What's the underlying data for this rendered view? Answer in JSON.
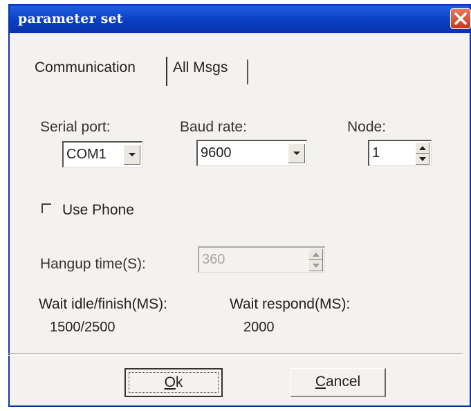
{
  "window": {
    "title": "parameter set"
  },
  "tabs": [
    {
      "label": "Communication",
      "active": true
    },
    {
      "label": "All Msgs",
      "active": false
    }
  ],
  "serial_port": {
    "label": "Serial port:",
    "value": "COM1"
  },
  "baud_rate": {
    "label": "Baud rate:",
    "value": "9600"
  },
  "node": {
    "label": "Node:",
    "value": "1"
  },
  "use_phone": {
    "label": "Use Phone",
    "checked": false
  },
  "hangup_time": {
    "label": "Hangup time(S):",
    "value": "360",
    "enabled": false
  },
  "wait_idle": {
    "label": "Wait idle/finish(MS):",
    "value": "1500/2500"
  },
  "wait_respond": {
    "label": "Wait respond(MS):",
    "value": "2000"
  },
  "buttons": {
    "ok_mnemonic": "O",
    "ok_rest": "k",
    "cancel_mnemonic": "C",
    "cancel_rest": "ancel"
  },
  "colors": {
    "titlebar": "#0a3fc4",
    "dialog_bg": "#f4f2ee",
    "close": "#c8381a"
  }
}
